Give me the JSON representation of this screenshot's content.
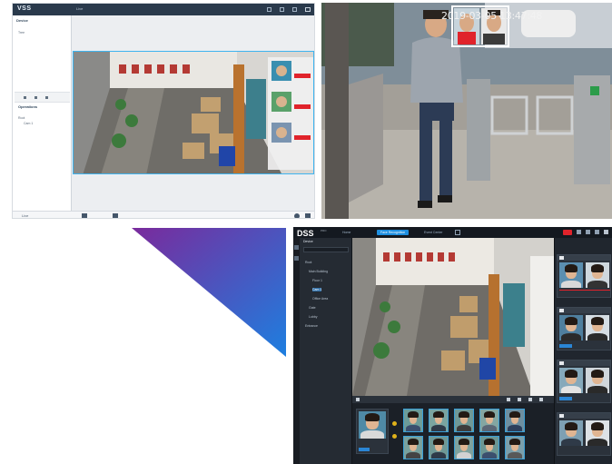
{
  "vss_client": {
    "brand": "VSS",
    "tab_label": "Live",
    "sidebar_title": "Device",
    "sidebar_rows": [
      "Tree",
      "Root",
      "Cam 1"
    ],
    "sidebar_section": "Operations",
    "bottom_label": "Live",
    "accent_color": "#3fb4ef"
  },
  "camera_view": {
    "timestamp": "2019-03-05 13:47:48",
    "match_box_color": "#e0232b"
  },
  "dss_client": {
    "brand": "DSS",
    "brand_sub": "PRO",
    "tabs": [
      {
        "label": "Home",
        "active": false
      },
      {
        "label": "Face Recognition",
        "active": true
      },
      {
        "label": "Event Center",
        "active": false
      }
    ],
    "tree_title": "Device",
    "tree_rows": [
      "Root",
      "Main Building",
      "Floor 1",
      "Cam 1",
      "Office Area",
      "Gate",
      "Lobby",
      "Entrance"
    ],
    "tree_selected_index": 3,
    "accent_color": "#1e8fe0",
    "alarm_color": "#e0232b"
  },
  "graphic": {
    "gradient_start": "#7a2a9c",
    "gradient_end": "#1d7fe0"
  }
}
